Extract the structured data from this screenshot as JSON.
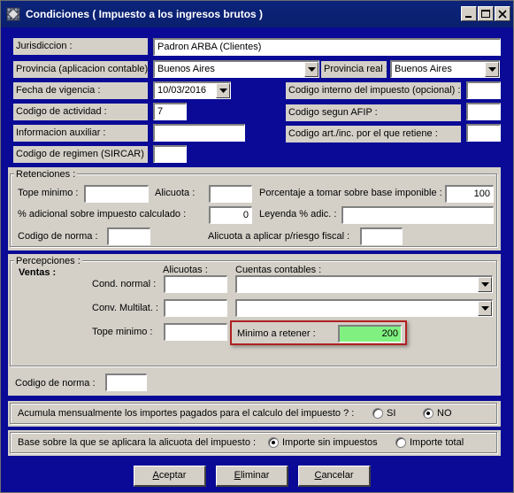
{
  "window": {
    "title": "Condiciones ( Impuesto a los ingresos brutos )"
  },
  "header_fields": {
    "jurisdiccion_label": "Jurisdiccion :",
    "jurisdiccion_value": "Padron ARBA (Clientes)",
    "provincia_contable_label": "Provincia (aplicacion contable)",
    "provincia_contable_value": "Buenos Aires",
    "provincia_real_label": "Provincia real :",
    "provincia_real_value": "Buenos Aires",
    "fecha_vigencia_label": "Fecha de vigencia :",
    "fecha_vigencia_value": "10/03/2016",
    "codigo_interno_label": "Codigo interno del impuesto (opcional) :",
    "codigo_interno_value": "",
    "codigo_actividad_label": "Codigo de actividad :",
    "codigo_actividad_value": "7",
    "codigo_afip_label": "Codigo segun AFIP :",
    "codigo_afip_value": "",
    "info_auxiliar_label": "Informacion auxiliar :",
    "info_auxiliar_value": "",
    "codigo_art_label": "Codigo art./inc. por el que retiene :",
    "codigo_art_value": "",
    "codigo_regimen_label": "Codigo de regimen (SIRCAR) :",
    "codigo_regimen_value": ""
  },
  "retenciones": {
    "group_label": "Retenciones :",
    "tope_minimo_label": "Tope minimo :",
    "tope_minimo_value": "",
    "alicuota_label": "Alicuota :",
    "alicuota_value": "",
    "porcentaje_label": "Porcentaje a tomar sobre base imponible :",
    "porcentaje_value": "100",
    "adicional_label": "% adicional sobre impuesto calculado :",
    "adicional_value": "0",
    "leyenda_label": "Leyenda % adic. :",
    "leyenda_value": "",
    "codigo_norma_label": "Codigo de norma :",
    "codigo_norma_value": "",
    "alicuota_riesgo_label": "Alicuota a aplicar p/riesgo fiscal :",
    "alicuota_riesgo_value": ""
  },
  "percepciones": {
    "group_label": "Percepciones :",
    "ventas_label": "Ventas :",
    "alicuotas_header": "Alicuotas :",
    "cuentas_header": "Cuentas contables :",
    "cond_normal_label": "Cond. normal :",
    "cond_normal_alicuota": "",
    "cond_normal_cuenta": "",
    "conv_multilat_label": "Conv. Multilat. :",
    "conv_multilat_alicuota": "",
    "conv_multilat_cuenta": "",
    "tope_minimo_label": "Tope minimo :",
    "tope_minimo_value": "",
    "minimo_retener_label": "Minimo a retener :",
    "minimo_retener_value": "200",
    "codigo_norma_label": "Codigo de norma :",
    "codigo_norma_value": ""
  },
  "acumula": {
    "question": "Acumula mensualmente los importes pagados para el calculo del impuesto ?   :",
    "si_label": "SI",
    "no_label": "NO",
    "selected": "NO"
  },
  "base": {
    "question": "Base sobre la que se aplicara la alicuota del impuesto  :",
    "sin_impuestos_label": "Importe sin impuestos",
    "total_label": "Importe total",
    "selected": "Importe sin impuestos"
  },
  "buttons": {
    "aceptar_first": "A",
    "aceptar_rest": "ceptar",
    "eliminar_first": "E",
    "eliminar_rest": "liminar",
    "cancelar_first": "C",
    "cancelar_rest": "ancelar"
  },
  "colors": {
    "window_bg": "#0a0a96",
    "highlight_field": "#80f080",
    "highlight_border": "#b02020"
  },
  "icons": {
    "title": "grid-app-icon",
    "minimize": "minimize-icon",
    "maximize": "maximize-icon",
    "close": "close-icon",
    "dropdown": "chevron-down-icon"
  }
}
